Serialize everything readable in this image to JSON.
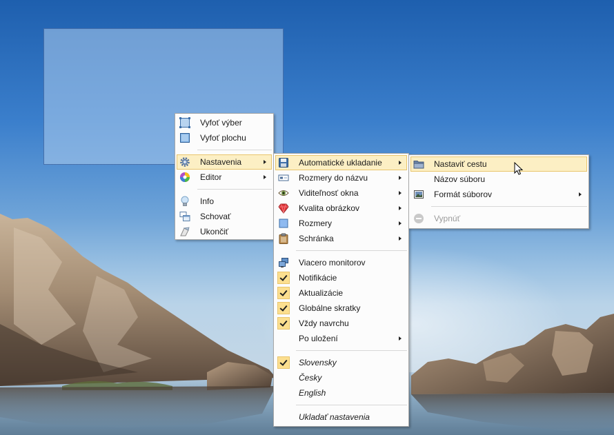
{
  "menu_main": {
    "items": [
      {
        "label": "Vyfoť výber",
        "icon": "select-region-icon"
      },
      {
        "label": "Vyfoť plochu",
        "icon": "desktop-icon"
      },
      {
        "label": "Nastavenia",
        "icon": "gear-icon",
        "submenu": true,
        "highlighted": true
      },
      {
        "label": "Editor",
        "icon": "color-wheel-icon",
        "submenu": true
      },
      {
        "label": "Info",
        "icon": "lightbulb-icon"
      },
      {
        "label": "Schovať",
        "icon": "windows-icon"
      },
      {
        "label": "Ukončiť",
        "icon": "exit-icon"
      }
    ]
  },
  "menu_settings": {
    "items": [
      {
        "label": "Automatické ukladanie",
        "icon": "floppy-icon",
        "submenu": true,
        "highlighted": true
      },
      {
        "label": "Rozmery do názvu",
        "icon": "dimensions-icon",
        "submenu": true
      },
      {
        "label": "Viditeľnosť okna",
        "icon": "eye-icon",
        "submenu": true
      },
      {
        "label": "Kvalita obrázkov",
        "icon": "ruby-icon",
        "submenu": true
      },
      {
        "label": "Rozmery",
        "icon": "square-icon",
        "submenu": true
      },
      {
        "label": "Schránka",
        "icon": "clipboard-icon",
        "submenu": true
      },
      {
        "label": "Viacero monitorov",
        "icon": "monitors-icon"
      },
      {
        "label": "Notifikácie",
        "checked": true
      },
      {
        "label": "Aktualizácie",
        "checked": true
      },
      {
        "label": "Globálne skratky",
        "checked": true
      },
      {
        "label": "Vždy navrchu",
        "checked": true
      },
      {
        "label": "Po uložení",
        "submenu": true
      },
      {
        "label": "Slovensky",
        "checked": true,
        "italic": true
      },
      {
        "label": "Česky",
        "italic": true
      },
      {
        "label": "English",
        "italic": true
      },
      {
        "label": "Ukladať nastavenia",
        "italic": true
      }
    ]
  },
  "menu_autosave": {
    "items": [
      {
        "label": "Nastaviť cestu",
        "icon": "folder-icon",
        "highlighted": true
      },
      {
        "label": "Názov súboru"
      },
      {
        "label": "Formát súborov",
        "icon": "image-icon",
        "submenu": true
      },
      {
        "label": "Vypnúť",
        "icon": "disabled-icon",
        "disabled": true
      }
    ]
  },
  "colors": {
    "highlight": "#fcefc4",
    "highlight_border": "#e9c56c",
    "check_bg": "#fcdf8f"
  }
}
